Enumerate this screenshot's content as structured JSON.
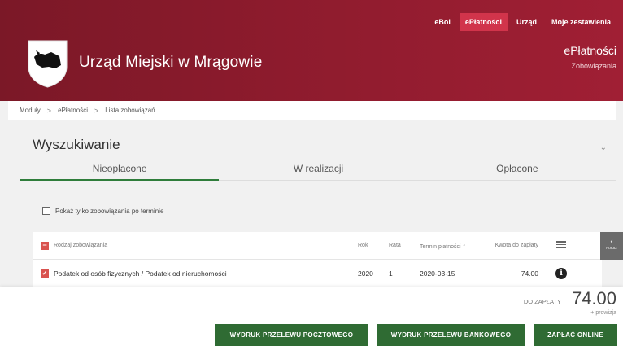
{
  "topnav": [
    {
      "label": "eBoi",
      "active": false
    },
    {
      "label": "ePłatności",
      "active": true
    },
    {
      "label": "Urząd",
      "active": false
    },
    {
      "label": "Moje zestawienia",
      "active": false
    }
  ],
  "header": {
    "title": "Urząd Miejski w Mrągowie",
    "module_title": "ePłatności",
    "module_subtitle": "Zobowiązania"
  },
  "breadcrumb": [
    "Moduły",
    "ePłatności",
    "Lista zobowiązań"
  ],
  "search": {
    "title": "Wyszukiwanie",
    "tabs": [
      "Nieopłacone",
      "W realizacji",
      "Opłacone"
    ],
    "active_tab": 0,
    "filter_label": "Pokaż tylko zobowiązania po terminie"
  },
  "table": {
    "headers": {
      "type": "Rodzaj zobowiązania",
      "rok": "Rok",
      "rata": "Rata",
      "termin": "Termin płatności",
      "kwota": "Kwota do zapłaty"
    },
    "rows": [
      {
        "type": "Podatek od osób fizycznych / Podatek od nieruchomości",
        "rok": "2020",
        "rata": "1",
        "termin": "2020-03-15",
        "kwota": "74.00"
      }
    ]
  },
  "side_tab": {
    "label": "POKAŻ"
  },
  "summary": {
    "due_label": "DO ZAPŁATY",
    "due_value": "74.00",
    "fee_note": "+ prowizja"
  },
  "buttons": {
    "postal": "WYDRUK PRZELEWU POCZTOWEGO",
    "bank": "WYDRUK PRZELEWU BANKOWEGO",
    "online": "ZAPŁAĆ ONLINE"
  },
  "colors": {
    "header": "#8d1b2d",
    "active_nav": "#d1344b",
    "primary_button": "#2f6b33",
    "checkbox_red": "#d9534f"
  }
}
